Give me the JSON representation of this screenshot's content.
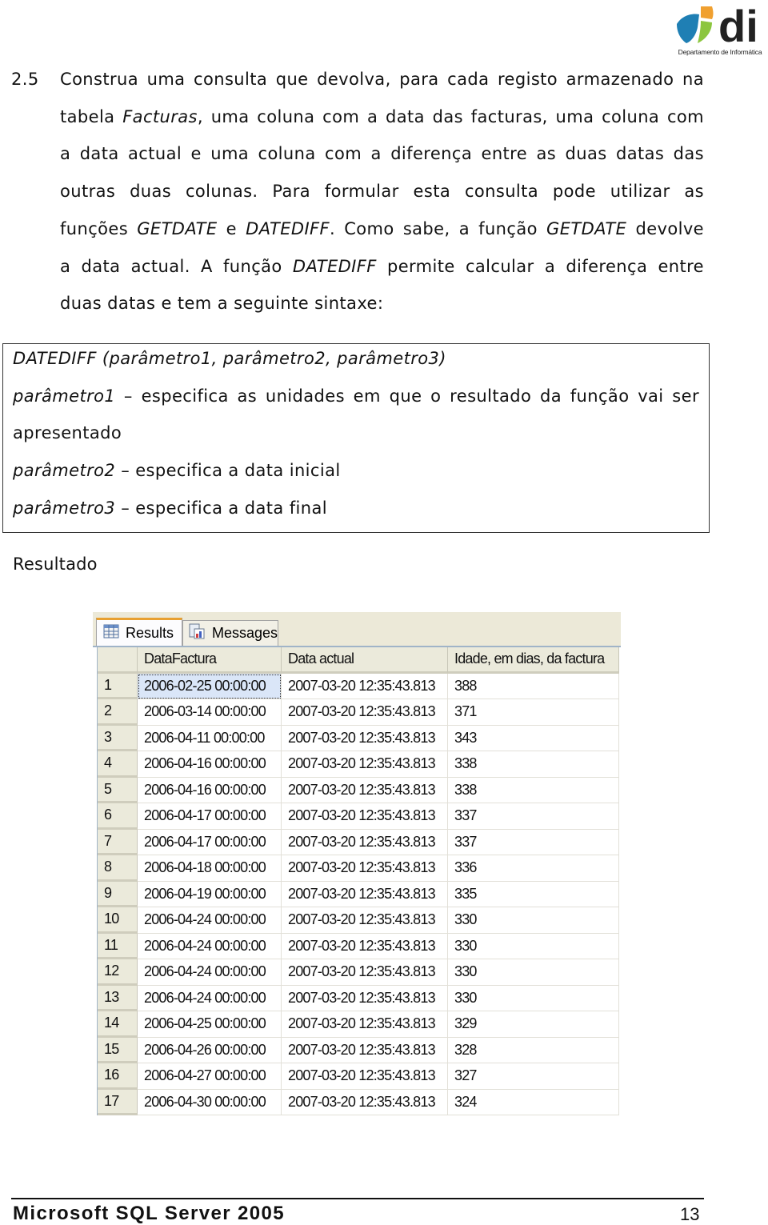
{
  "logo": {
    "mark": "di",
    "subtitle": "Departamento de Informática",
    "colors": {
      "blue": "#1f7fb4",
      "orange": "#f0a030",
      "green": "#8cc63f",
      "text": "#222222"
    }
  },
  "exercise": {
    "number": "2.5",
    "lines": [
      [
        {
          "t": "Construa uma consulta que devolva, para cada registo armazenado na"
        }
      ],
      [
        {
          "t": "tabela "
        },
        {
          "t": "Facturas",
          "i": true
        },
        {
          "t": ", uma coluna com a data das facturas, uma coluna com"
        }
      ],
      [
        {
          "t": "a data actual e uma coluna com a diferença entre as duas datas das"
        }
      ],
      [
        {
          "t": "outras duas colunas. Para formular esta consulta pode utilizar as"
        }
      ],
      [
        {
          "t": "funções "
        },
        {
          "t": "GETDATE",
          "i": true
        },
        {
          "t": " e "
        },
        {
          "t": "DATEDIFF",
          "i": true
        },
        {
          "t": ". Como sabe, a função "
        },
        {
          "t": "GETDATE",
          "i": true
        },
        {
          "t": " devolve"
        }
      ],
      [
        {
          "t": "a data actual. A função "
        },
        {
          "t": "DATEDIFF",
          "i": true
        },
        {
          "t": " permite calcular a diferença entre"
        }
      ],
      [
        {
          "t": "duas datas e tem a seguinte sintaxe:"
        }
      ]
    ]
  },
  "syntax_box": {
    "lines": [
      [
        {
          "t": "DATEDIFF (parâmetro1, parâmetro2, parâmetro3)",
          "i": true
        }
      ],
      [
        {
          "t": "parâmetro1",
          "i": true
        },
        {
          "t": " – especifica as unidades em que o resultado da função vai ser"
        }
      ],
      [
        {
          "t": "apresentado"
        }
      ],
      [
        {
          "t": "parâmetro2",
          "i": true
        },
        {
          "t": " – especifica a data inicial"
        }
      ],
      [
        {
          "t": "parâmetro3",
          "i": true
        },
        {
          "t": " – especifica a data final"
        }
      ]
    ]
  },
  "resultado_label": "Resultado",
  "results_pane": {
    "tabs": [
      {
        "label": "Results",
        "icon": "grid-icon",
        "active": true
      },
      {
        "label": "Messages",
        "icon": "messages-icon",
        "active": false
      }
    ],
    "columns": [
      "",
      "DataFactura",
      "Data actual",
      "Idade, em dias, da factura"
    ],
    "rows": [
      [
        "1",
        "2006-02-25 00:00:00",
        "2007-03-20 12:35:43.813",
        "388"
      ],
      [
        "2",
        "2006-03-14 00:00:00",
        "2007-03-20 12:35:43.813",
        "371"
      ],
      [
        "3",
        "2006-04-11 00:00:00",
        "2007-03-20 12:35:43.813",
        "343"
      ],
      [
        "4",
        "2006-04-16 00:00:00",
        "2007-03-20 12:35:43.813",
        "338"
      ],
      [
        "5",
        "2006-04-16 00:00:00",
        "2007-03-20 12:35:43.813",
        "338"
      ],
      [
        "6",
        "2006-04-17 00:00:00",
        "2007-03-20 12:35:43.813",
        "337"
      ],
      [
        "7",
        "2006-04-17 00:00:00",
        "2007-03-20 12:35:43.813",
        "337"
      ],
      [
        "8",
        "2006-04-18 00:00:00",
        "2007-03-20 12:35:43.813",
        "336"
      ],
      [
        "9",
        "2006-04-19 00:00:00",
        "2007-03-20 12:35:43.813",
        "335"
      ],
      [
        "10",
        "2006-04-24 00:00:00",
        "2007-03-20 12:35:43.813",
        "330"
      ],
      [
        "11",
        "2006-04-24 00:00:00",
        "2007-03-20 12:35:43.813",
        "330"
      ],
      [
        "12",
        "2006-04-24 00:00:00",
        "2007-03-20 12:35:43.813",
        "330"
      ],
      [
        "13",
        "2006-04-24 00:00:00",
        "2007-03-20 12:35:43.813",
        "330"
      ],
      [
        "14",
        "2006-04-25 00:00:00",
        "2007-03-20 12:35:43.813",
        "329"
      ],
      [
        "15",
        "2006-04-26 00:00:00",
        "2007-03-20 12:35:43.813",
        "328"
      ],
      [
        "16",
        "2006-04-27 00:00:00",
        "2007-03-20 12:35:43.813",
        "327"
      ],
      [
        "17",
        "2006-04-30 00:00:00",
        "2007-03-20 12:35:43.813",
        "324"
      ]
    ],
    "selected_cell": {
      "row": 1,
      "column": "DataFactura"
    }
  },
  "footer": {
    "title": "Microsoft SQL Server 2005",
    "page_number": "13"
  }
}
